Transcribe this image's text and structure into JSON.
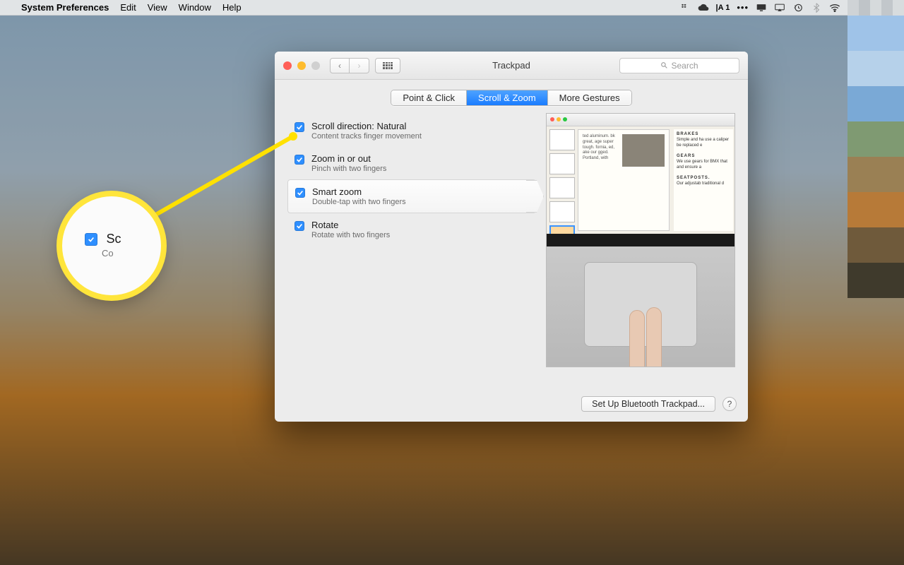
{
  "menubar": {
    "app_name": "System Preferences",
    "items": [
      "Edit",
      "View",
      "Window",
      "Help"
    ],
    "status_text": "A 1"
  },
  "window": {
    "title": "Trackpad",
    "search_placeholder": "Search",
    "tabs": [
      {
        "label": "Point & Click",
        "active": false
      },
      {
        "label": "Scroll & Zoom",
        "active": true
      },
      {
        "label": "More Gestures",
        "active": false
      }
    ],
    "options": [
      {
        "title": "Scroll direction: Natural",
        "subtitle": "Content tracks finger movement",
        "checked": true,
        "selected": false
      },
      {
        "title": "Zoom in or out",
        "subtitle": "Pinch with two fingers",
        "checked": true,
        "selected": false
      },
      {
        "title": "Smart zoom",
        "subtitle": "Double-tap with two fingers",
        "checked": true,
        "selected": true
      },
      {
        "title": "Rotate",
        "subtitle": "Rotate with two fingers",
        "checked": true,
        "selected": false
      }
    ],
    "preview_text": {
      "h1": "BRAKES",
      "p1": "Simple and ha use a caliper be replaced e",
      "h2": "GEARS",
      "p2": "We use gears for BMX that and ensure a",
      "h3": "SEATPOSTS.",
      "p3": "Our adjustab traditional d",
      "page": "ted aluminum. bk great, age super tough. fornia, ed, ake our gged. Portland, with"
    },
    "footer_button": "Set Up Bluetooth Trackpad...",
    "help": "?"
  },
  "callout": {
    "title": "Sc",
    "subtitle": "Co"
  }
}
